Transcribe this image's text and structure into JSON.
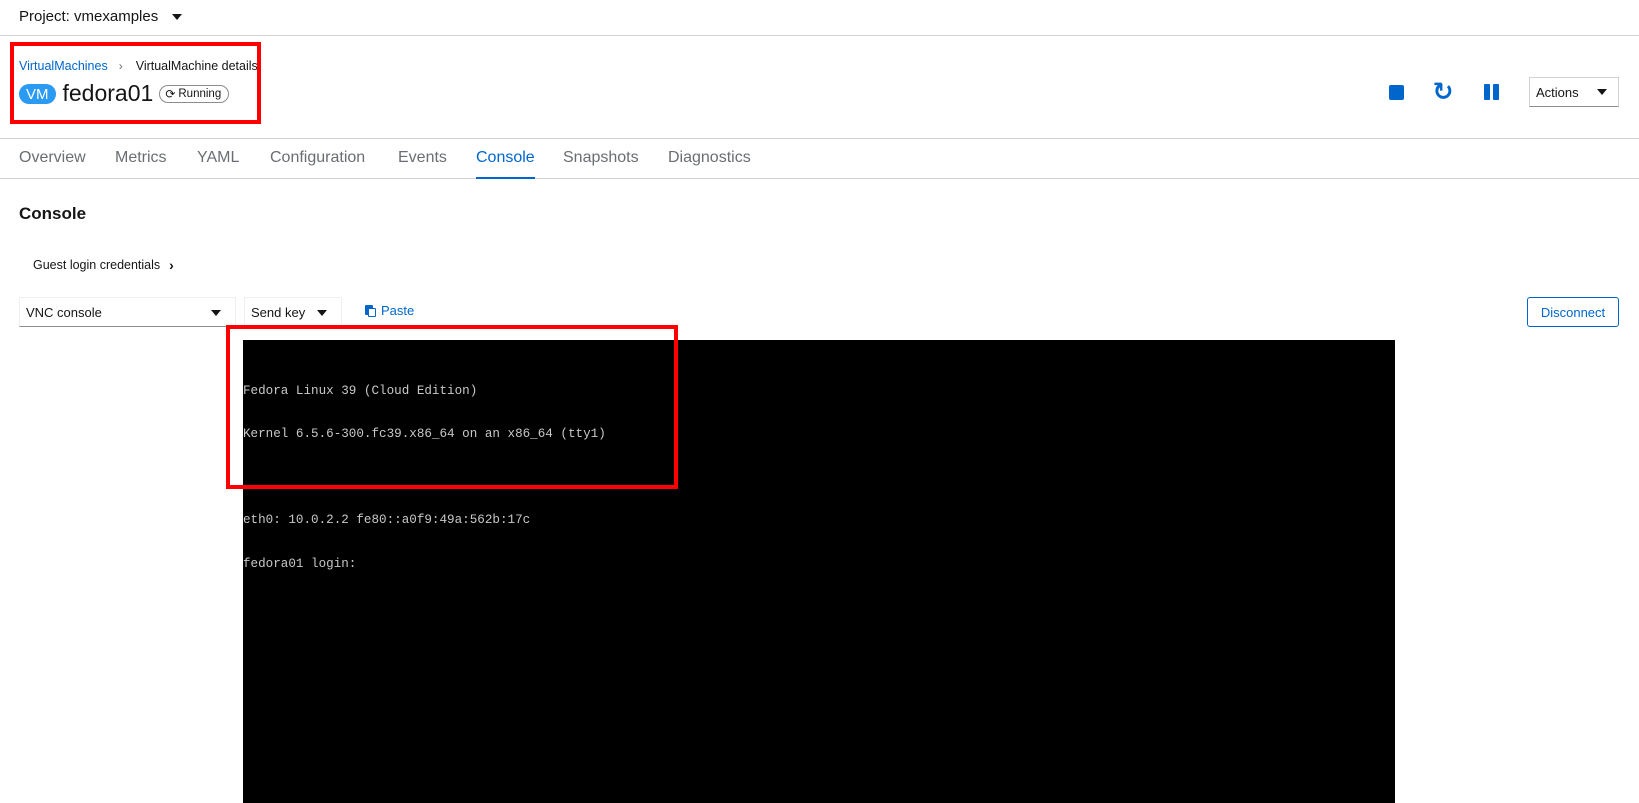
{
  "project_bar": {
    "label": "Project: vmexamples"
  },
  "breadcrumb": {
    "parent": "VirtualMachines",
    "current": "VirtualMachine details"
  },
  "vm": {
    "badge": "VM",
    "name": "fedora01",
    "status": "Running"
  },
  "header_actions": {
    "actions_label": "Actions"
  },
  "tabs": [
    {
      "label": "Overview",
      "active": false
    },
    {
      "label": "Metrics",
      "active": false
    },
    {
      "label": "YAML",
      "active": false
    },
    {
      "label": "Configuration",
      "active": false
    },
    {
      "label": "Events",
      "active": false
    },
    {
      "label": "Console",
      "active": true
    },
    {
      "label": "Snapshots",
      "active": false
    },
    {
      "label": "Diagnostics",
      "active": false
    }
  ],
  "console": {
    "title": "Console",
    "guest_credentials_label": "Guest login credentials",
    "console_type": "VNC console",
    "send_key_label": "Send key",
    "paste_label": "Paste",
    "disconnect_label": "Disconnect",
    "screen_lines": [
      "Fedora Linux 39 (Cloud Edition)",
      "Kernel 6.5.6-300.fc39.x86_64 on an x86_64 (tty1)",
      "",
      "eth0: 10.0.2.2 fe80::a0f9:49a:562b:17c",
      "fedora01 login:"
    ]
  },
  "colors": {
    "accent": "#0066cc",
    "vm_badge": "#2b9af3",
    "highlight": "#ff0000",
    "console_bg": "#000000"
  },
  "icons": {
    "stop": "stop-icon",
    "restart": "restart-icon",
    "pause": "pause-icon",
    "status": "sync-icon",
    "paste": "paste-icon"
  }
}
